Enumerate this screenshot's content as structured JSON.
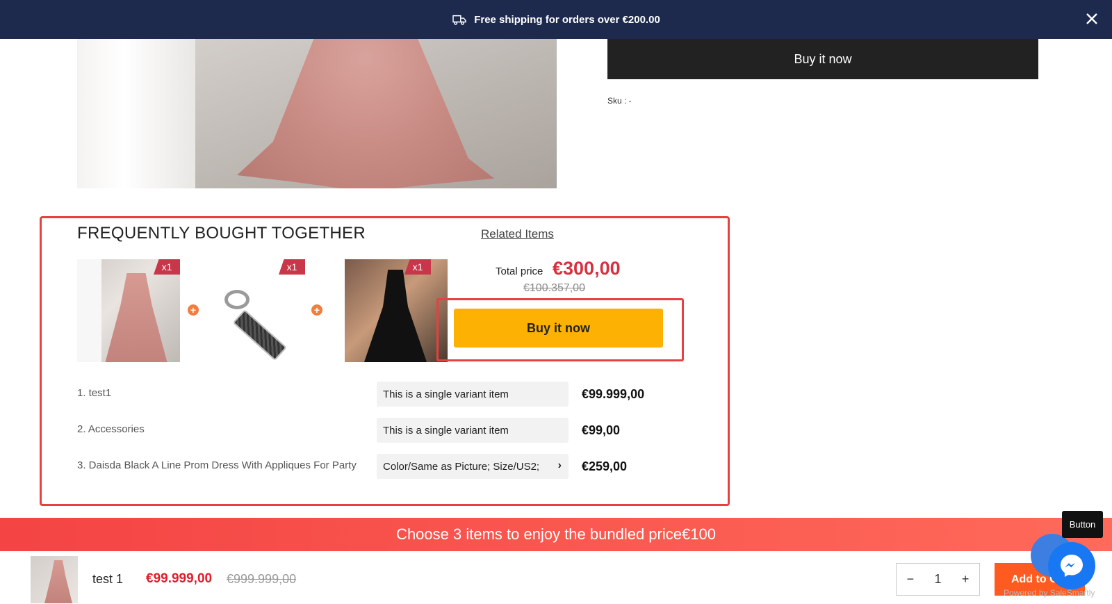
{
  "announcement": {
    "text": "Free shipping for orders over €200.00",
    "icon": "truck-icon"
  },
  "product": {
    "buy_now_label": "Buy it now",
    "sku_text": "Sku : -"
  },
  "fbt": {
    "title": "FREQUENTLY BOUGHT TOGETHER",
    "related_link": "Related Items",
    "badges": [
      "x1",
      "x1",
      "x1"
    ],
    "total_label": "Total price",
    "total_price": "€300,00",
    "old_total": "€100.357,00",
    "buy_label": "Buy it now",
    "items": [
      {
        "name": "1. test1",
        "variant": "This is a single variant item",
        "price": "€99.999,00"
      },
      {
        "name": "2. Accessories",
        "variant": "This is a single variant item",
        "price": "€99,00"
      },
      {
        "name": "3. Daisda Black A Line Prom Dress With Appliques For Party",
        "variant": "Color/Same as Picture; Size/US2;",
        "price": "€259,00"
      }
    ]
  },
  "bundle_banner": "Choose 3 items to enjoy the bundled price€100",
  "sticky_bar": {
    "name": "test 1",
    "price": "€99.999,00",
    "old_price": "€999.999,00",
    "qty_minus": "−",
    "qty_value": "1",
    "qty_plus": "+",
    "add_to_cart": "Add to Ca",
    "powered": "Powered by SaleSmartly",
    "tooltip": "Button"
  },
  "colors": {
    "topbar": "#1d2a4d",
    "accent_red": "#e84040",
    "buy_yellow": "#fdb203",
    "price_red": "#d6313f",
    "banner": "#f44444",
    "add_cart": "#ff5a1f"
  }
}
